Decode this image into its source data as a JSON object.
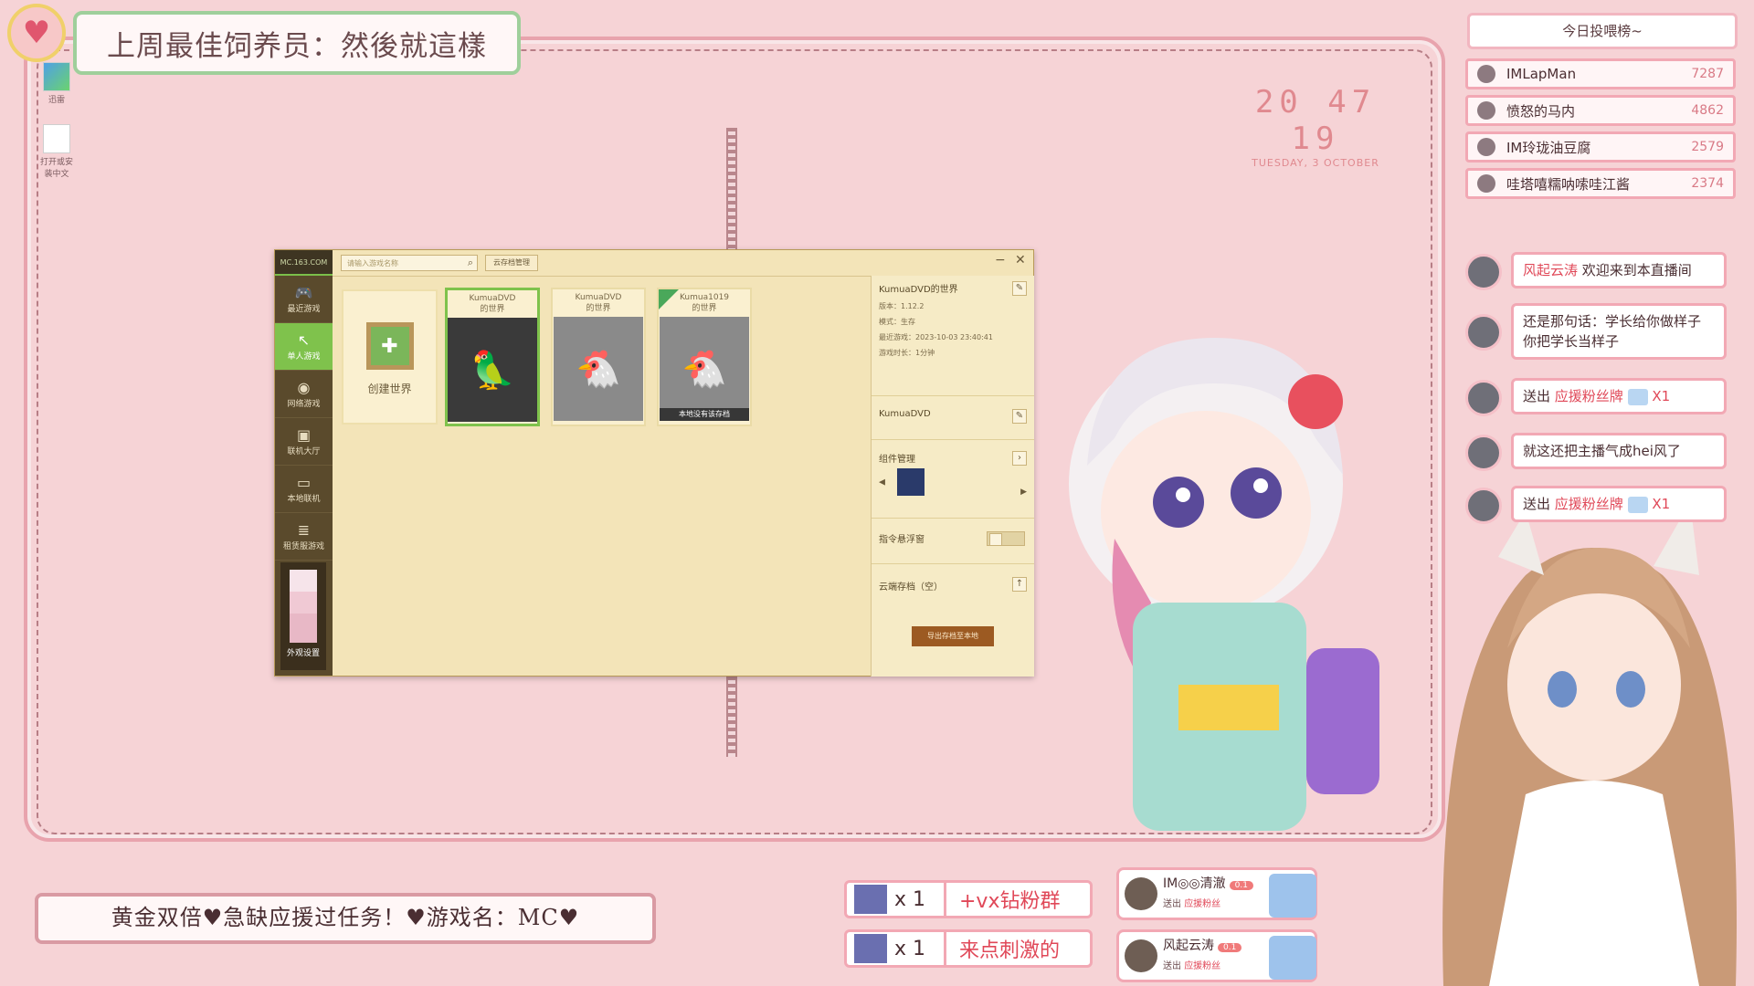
{
  "banner": {
    "title": "上周最佳饲养员：然後就這樣"
  },
  "desktop": {
    "icons": [
      {
        "label": "迅雷"
      },
      {
        "label": "打开或安装中文"
      }
    ]
  },
  "clock": {
    "time": "20 47 19",
    "date": "TUESDAY, 3 OCTOBER"
  },
  "launcher": {
    "logo": "MC.163.COM",
    "search_placeholder": "请输入游戏名称",
    "cloud_button": "云存档管理",
    "nav": [
      {
        "icon": "gamepad-icon",
        "label": "最近游戏"
      },
      {
        "icon": "arrow-icon",
        "label": "单人游戏"
      },
      {
        "icon": "globe-icon",
        "label": "网络游戏"
      },
      {
        "icon": "lobby-icon",
        "label": "联机大厅"
      },
      {
        "icon": "monitor-icon",
        "label": "本地联机"
      },
      {
        "icon": "list-icon",
        "label": "租赁服游戏"
      }
    ],
    "avatar_label": "外观设置",
    "create_label": "创建世界",
    "worlds": [
      {
        "name": "KumuaDVD",
        "sub": "的世界"
      },
      {
        "name": "KumuaDVD",
        "sub": "的世界"
      },
      {
        "name": "Kumua1019",
        "sub": "的世界",
        "note": "本地没有该存档"
      }
    ],
    "detail": {
      "world_title": "KumuaDVD的世界",
      "version": "版本：1.12.2",
      "mode": "模式：生存",
      "last_played": "最近游戏：2023-10-03 23:40:41",
      "duration": "游戏时长：1分钟",
      "player": "KumuaDVD",
      "mods_title": "组件管理",
      "cmd_title": "指令悬浮窗",
      "cloud_title": "云端存档（空）",
      "export_button": "导出存档至本地"
    }
  },
  "leaderboard": {
    "title": "今日投喂榜~",
    "rows": [
      {
        "name": "IMLapMan",
        "score": "7287"
      },
      {
        "name": "愤怒的马内",
        "score": "4862"
      },
      {
        "name": "IM玲珑油豆腐",
        "score": "2579"
      },
      {
        "name": "哇塔嘻糯呐嗦哇江酱",
        "score": "2374"
      }
    ]
  },
  "chat": [
    {
      "user": "风起云涛",
      "text": "欢迎来到本直播间"
    },
    {
      "text": "还是那句话：学长给你做样子 你把学长当样子"
    },
    {
      "prefix": "送出",
      "gift": "应援粉丝牌",
      "count": "X1"
    },
    {
      "text": "就这还把主播气成hei风了"
    },
    {
      "prefix": "送出",
      "gift": "应援粉丝牌",
      "count": "X1"
    }
  ],
  "marquee": {
    "text": "黄金双倍♥急缺应援过任务！♥游戏名：MC♥"
  },
  "goals": [
    {
      "count": "x 1",
      "label": "+vx钻粉群"
    },
    {
      "count": "x 1",
      "label": "来点刺激的"
    }
  ],
  "supporters": [
    {
      "name": "IM◎◎清澈",
      "level": "0.1",
      "action": "送出",
      "gift": "应援粉丝"
    },
    {
      "name": "风起云涛",
      "level": "0.1",
      "action": "送出",
      "gift": "应援粉丝"
    }
  ],
  "colors": {
    "accent": "#f2a8b4",
    "launcher_green": "#7fc24c",
    "alert_red": "#e04858"
  }
}
